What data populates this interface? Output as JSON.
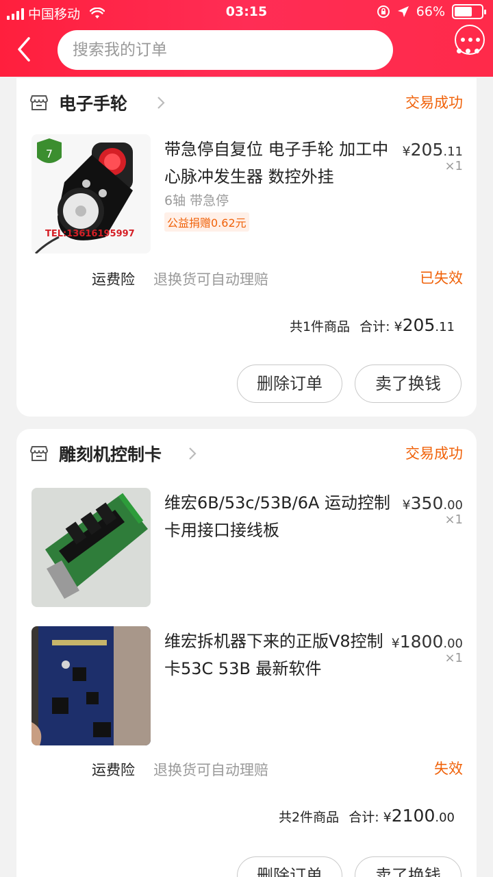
{
  "status_bar": {
    "carrier": "中国移动",
    "time": "03:15",
    "battery": "66%",
    "battery_level": 0.66
  },
  "header": {
    "search_placeholder": "搜索我的订单"
  },
  "orders": [
    {
      "shop_name": "电子手轮",
      "status": "交易成功",
      "items": [
        {
          "title": "带急停自复位 电子手轮  加工中心脉冲发生器 数控外挂",
          "sku": "6轴 带急停",
          "charity": "公益捐赠0.62元",
          "price_currency": "¥",
          "price_int": "205",
          "price_dec": ".11",
          "qty": "×1",
          "thumb_text": "TEL:13616195997"
        }
      ],
      "insurance": {
        "label": "运费险",
        "desc": "退换货可自动理赔",
        "status": "已失效"
      },
      "summary": {
        "count_text": "共1件商品",
        "total_label": "合计:",
        "currency": "¥",
        "total_int": "205",
        "total_dec": ".11"
      },
      "buttons": {
        "delete": "删除订单",
        "resell": "卖了换钱"
      }
    },
    {
      "shop_name": "雕刻机控制卡",
      "status": "交易成功",
      "items": [
        {
          "title": "维宏6B/53c/53B/6A 运动控制卡用接口接线板",
          "price_currency": "¥",
          "price_int": "350",
          "price_dec": ".00",
          "qty": "×1"
        },
        {
          "title": "维宏拆机器下来的正版V8控制卡53C 53B 最新软件",
          "price_currency": "¥",
          "price_int": "1800",
          "price_dec": ".00",
          "qty": "×1"
        }
      ],
      "insurance": {
        "label": "运费险",
        "desc": "退换货可自动理赔",
        "status": "失效"
      },
      "summary": {
        "count_text": "共2件商品",
        "total_label": "合计:",
        "currency": "¥",
        "total_int": "2100",
        "total_dec": ".00"
      },
      "buttons": {
        "delete": "删除订单",
        "resell": "卖了换钱"
      }
    }
  ]
}
